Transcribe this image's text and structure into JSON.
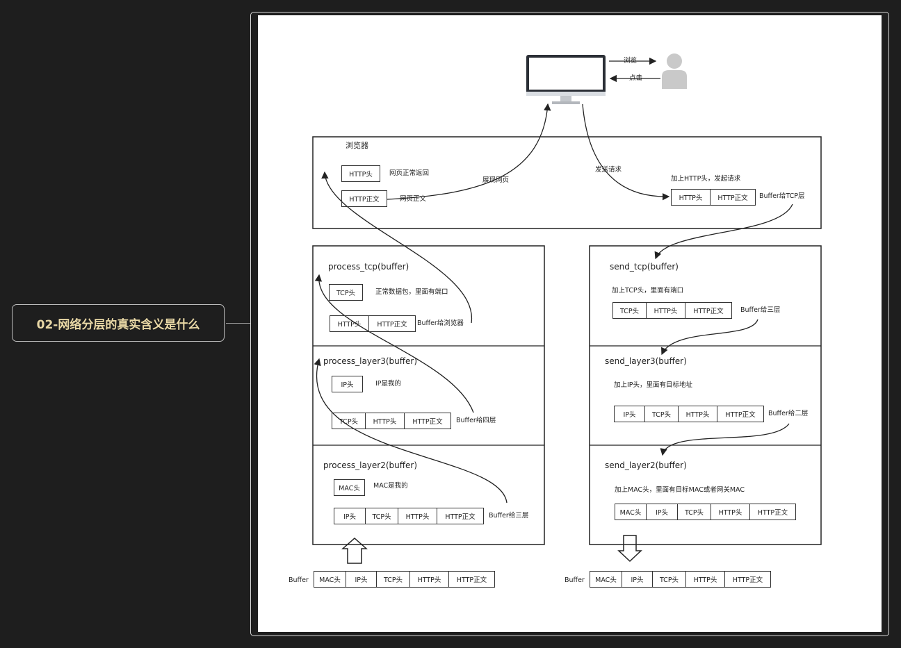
{
  "topic": {
    "title": "02-网络分层的真实含义是什么"
  },
  "diagram": {
    "top": {
      "browse": "浏览",
      "click": "点击"
    },
    "browser": {
      "title": "浏览器",
      "http_head": "HTTP头",
      "http_body": "HTTP正文",
      "page_ok": "网页正常返回",
      "page_body": "网页正文",
      "show_page": "展现网页",
      "send_request": "发送请求",
      "add_http": "加上HTTP头，发起请求",
      "buffer_to_tcp": "Buffer给TCP层",
      "cells": [
        "HTTP头",
        "HTTP正文"
      ]
    },
    "process_tcp": {
      "title": "process_tcp(buffer)",
      "tcp_head": "TCP头",
      "note": "正常数据包，里面有端口",
      "cells": [
        "HTTP头",
        "HTTP正文"
      ],
      "buffer_label": "Buffer给浏览器"
    },
    "process_layer3": {
      "title": "process_layer3(buffer)",
      "ip_head": "IP头",
      "note": "IP是我的",
      "cells": [
        "TCP头",
        "HTTP头",
        "HTTP正文"
      ],
      "buffer_label": "Buffer给四层"
    },
    "process_layer2": {
      "title": "process_layer2(buffer)",
      "mac_head": "MAC头",
      "note": "MAC是我的",
      "cells": [
        "IP头",
        "TCP头",
        "HTTP头",
        "HTTP正文"
      ],
      "buffer_label": "Buffer给三层"
    },
    "send_tcp": {
      "title": "send_tcp(buffer)",
      "note": "加上TCP头，里面有端口",
      "cells": [
        "TCP头",
        "HTTP头",
        "HTTP正文"
      ],
      "buffer_label": "Buffer给三层"
    },
    "send_layer3": {
      "title": "send_layer3(buffer)",
      "note": "加上IP头，里面有目标地址",
      "cells": [
        "IP头",
        "TCP头",
        "HTTP头",
        "HTTP正文"
      ],
      "buffer_label": "Buffer给二层"
    },
    "send_layer2": {
      "title": "send_layer2(buffer)",
      "note": "加上MAC头，里面有目标MAC或者网关MAC",
      "cells": [
        "MAC头",
        "IP头",
        "TCP头",
        "HTTP头",
        "HTTP正文"
      ]
    },
    "buffer_in": {
      "label": "Buffer",
      "cells": [
        "MAC头",
        "IP头",
        "TCP头",
        "HTTP头",
        "HTTP正文"
      ]
    },
    "buffer_out": {
      "label": "Buffer",
      "cells": [
        "MAC头",
        "IP头",
        "TCP头",
        "HTTP头",
        "HTTP正文"
      ]
    }
  }
}
